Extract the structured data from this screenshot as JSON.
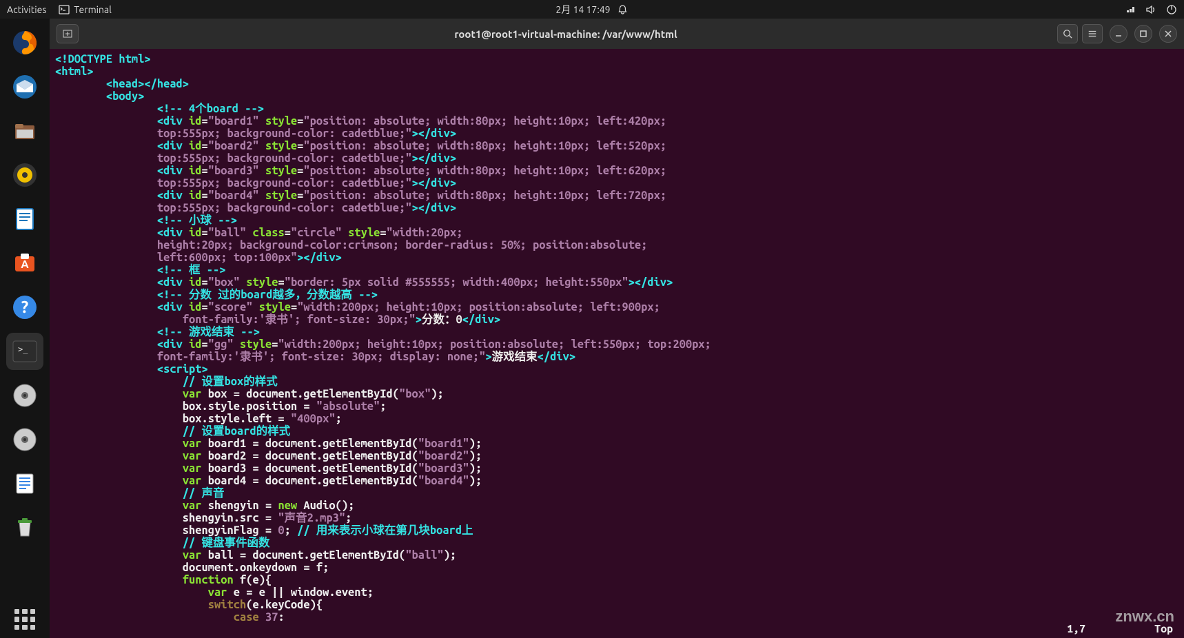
{
  "topbar": {
    "activities": "Activities",
    "terminal": "Terminal",
    "datetime": "2月 14  17:49"
  },
  "dock": {
    "items": [
      {
        "name": "firefox",
        "color": "#e66000"
      },
      {
        "name": "thunderbird",
        "color": "#1f6fb0"
      },
      {
        "name": "files",
        "color": "#8b5a3c"
      },
      {
        "name": "rhythmbox",
        "color": "#f0c000"
      },
      {
        "name": "libreoffice-writer",
        "color": "#1a75bb"
      },
      {
        "name": "software",
        "color": "#e95420"
      },
      {
        "name": "help",
        "color": "#3689e6"
      },
      {
        "name": "terminal",
        "color": "#2c2c2c"
      },
      {
        "name": "disc1",
        "color": "#888888"
      },
      {
        "name": "disc2",
        "color": "#888888"
      },
      {
        "name": "text-editor",
        "color": "#3584e4"
      },
      {
        "name": "trash",
        "color": "#4a9a3a"
      }
    ]
  },
  "window": {
    "title": "root1@root1-virtual-machine: /var/www/html"
  },
  "vim_status": {
    "position": "1,7",
    "scroll": "Top"
  },
  "watermark": "znwx.cn",
  "code": {
    "line01_doctype": "<!DOCTYPE html>",
    "line02_html_open": "<html>",
    "line03_head": "<head></head>",
    "line04_body_open": "<body>",
    "line05_comment_boards": "<!-- 4个board -->",
    "board1": {
      "id": "board1",
      "style": "position: absolute; width:80px; height:10px; left:420px; top:555px; background-color: cadetblue;"
    },
    "board2": {
      "id": "board2",
      "style": "position: absolute; width:80px; height:10px; left:520px; top:555px; background-color: cadetblue;"
    },
    "board3": {
      "id": "board3",
      "style": "position: absolute; width:80px; height:10px; left:620px; top:555px; background-color: cadetblue;"
    },
    "board4": {
      "id": "board4",
      "style": "position: absolute; width:80px; height:10px; left:720px; top:555px; background-color: cadetblue;"
    },
    "comment_ball": "<!-- 小球 -->",
    "ball": {
      "id": "ball",
      "class": "circle",
      "style": "width:20px; height:20px; background-color:crimson; border-radius: 50%; position:absolute; left:600px; top:100px"
    },
    "comment_box": "<!-- 框 -->",
    "box": {
      "id": "box",
      "style": "border: 5px solid #555555; width:400px; height:550px"
    },
    "comment_score": "<!-- 分数 过的board越多，分数越高 -->",
    "score": {
      "id": "score",
      "style": "width:200px; height:10px; position:absolute; left:900px;",
      "font": "font-family:'隶书'; font-size: 30px;",
      "text": "分数：0"
    },
    "comment_gameover": "<!-- 游戏结束 -->",
    "gg": {
      "id": "gg",
      "style": "width:200px; height:10px; position:absolute; left:550px; top:200px; font-family:'隶书'; font-size: 30px; display: none;",
      "text": "游戏结束"
    },
    "script_open": "<script>",
    "js_comment_box": "// 设置box的样式",
    "js_box_get": "var box = document.getElementById(\"box\");",
    "js_box_pos": "box.style.position = \"absolute\";",
    "js_box_left": "box.style.left = \"400px\";",
    "js_comment_board": "// 设置board的样式",
    "js_board1": "var board1 = document.getElementById(\"board1\");",
    "js_board2": "var board2 = document.getElementById(\"board2\");",
    "js_board3": "var board3 = document.getElementById(\"board3\");",
    "js_board4": "var board4 = document.getElementById(\"board4\");",
    "js_comment_sound": "// 声音",
    "js_audio_new": "var shengyin = new Audio();",
    "js_audio_src": "shengyin.src = \"声音2.mp3\";",
    "js_audio_flag": "shengyinFlag = 0; // 用来表示小球在第几块board上",
    "js_comment_key": "// 键盘事件函数",
    "js_ball_get": "var ball = document.getElementById(\"ball\");",
    "js_onkeydown": "document.onkeydown = f;",
    "js_func": "function f(e){",
    "js_evt": "var e = e || window.event;",
    "js_switch": "switch(e.keyCode){",
    "js_case": "case 37:"
  }
}
